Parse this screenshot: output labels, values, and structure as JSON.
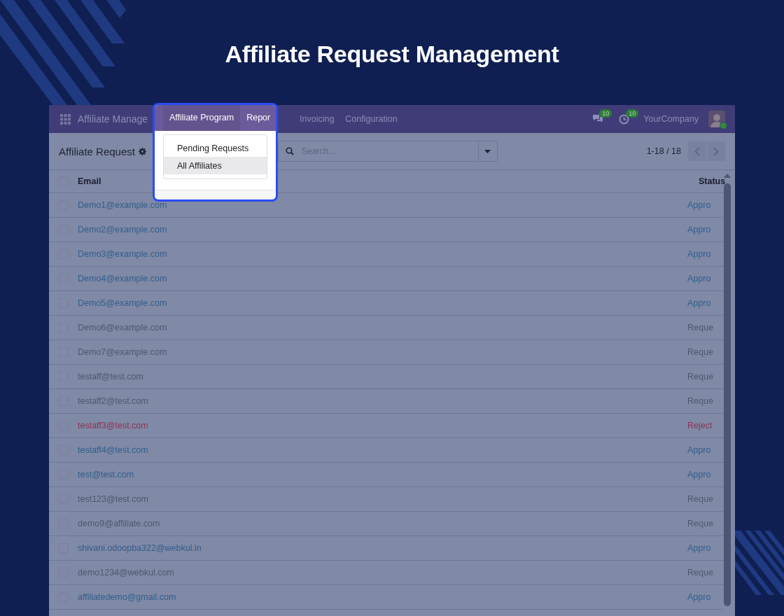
{
  "page_title": "Affiliate Request Management",
  "navbar": {
    "app_name": "Affiliate Manage",
    "menus": [
      {
        "label": "Affiliate Program",
        "selected": true,
        "in_focus": true
      },
      {
        "label": "Repor",
        "selected": false,
        "in_focus": true
      },
      {
        "label": "Invoicing",
        "selected": false,
        "in_focus": false
      },
      {
        "label": "Configuration",
        "selected": false,
        "in_focus": false
      }
    ],
    "messages_badge": "10",
    "activities_badge": "10",
    "company": "YourCompany"
  },
  "dropdown": {
    "items": [
      {
        "label": "Pending Requests",
        "selected": false
      },
      {
        "label": "All Affiliates",
        "selected": true
      }
    ]
  },
  "control_panel": {
    "breadcrumb": "Affiliate Request",
    "search": {
      "placeholder": "Search..."
    },
    "pager": "1-18 / 18"
  },
  "table": {
    "columns": [
      "Email",
      "Status"
    ],
    "select_all_checked": false,
    "rows": [
      {
        "email": "Demo1@example.com",
        "status": "Appro",
        "kind": "approved",
        "checked": false
      },
      {
        "email": "Demo2@example.com",
        "status": "Appro",
        "kind": "approved",
        "checked": false
      },
      {
        "email": "Demo3@example.com",
        "status": "Appro",
        "kind": "approved",
        "checked": false
      },
      {
        "email": "Demo4@example.com",
        "status": "Appro",
        "kind": "approved",
        "checked": false
      },
      {
        "email": "Demo5@example.com",
        "status": "Appro",
        "kind": "approved",
        "checked": false
      },
      {
        "email": "Demo6@example.com",
        "status": "Reque",
        "kind": "requested",
        "checked": false
      },
      {
        "email": "Demo7@example.com",
        "status": "Reque",
        "kind": "requested",
        "checked": false
      },
      {
        "email": "testaff@test.com",
        "status": "Reque",
        "kind": "requested",
        "checked": false
      },
      {
        "email": "testaff2@test.com",
        "status": "Reque",
        "kind": "requested",
        "checked": false
      },
      {
        "email": "testaff3@test.com",
        "status": "Reject",
        "kind": "rejected",
        "checked": false
      },
      {
        "email": "testaff4@test.com",
        "status": "Appro",
        "kind": "approved",
        "checked": false
      },
      {
        "email": "test@test.com",
        "status": "Appro",
        "kind": "approved",
        "checked": false
      },
      {
        "email": "test123@test.com",
        "status": "Reque",
        "kind": "requested",
        "checked": false
      },
      {
        "email": "demo9@affiliate.com",
        "status": "Reque",
        "kind": "requested",
        "checked": false
      },
      {
        "email": "shivani.odoopba322@webkul.in",
        "status": "Appro",
        "kind": "approved",
        "checked": false
      },
      {
        "email": "demo1234@webkul.com",
        "status": "Reque",
        "kind": "requested",
        "checked": false
      },
      {
        "email": "affiliatedemo@gmail.com",
        "status": "Appro",
        "kind": "approved",
        "checked": false
      }
    ]
  }
}
